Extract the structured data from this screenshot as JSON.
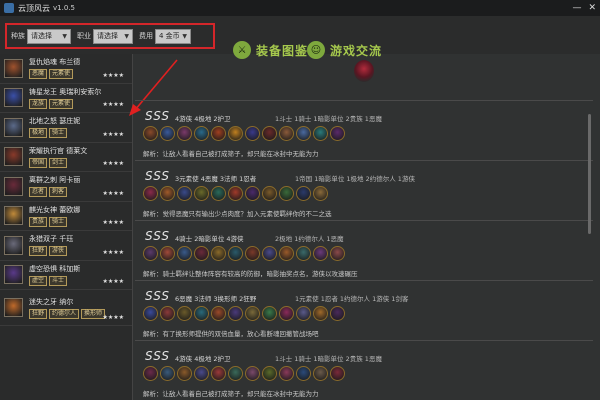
{
  "window": {
    "title": "云顶风云",
    "version": "v1.0.5",
    "buttons": [
      "—",
      "✕"
    ]
  },
  "filters": [
    {
      "label": "种族",
      "value": "请选择"
    },
    {
      "label": "职业",
      "value": "请选择"
    },
    {
      "label": "费用",
      "value": "4 金币"
    }
  ],
  "nav": [
    {
      "label": "装备图鉴",
      "icon": "sword-icon"
    },
    {
      "label": "游戏交流",
      "icon": "chat-icon"
    }
  ],
  "heroes": [
    {
      "name": "复仇焰魂 布兰德",
      "tags": [
        "恶魔",
        "元素使"
      ],
      "stars": "★★★★",
      "color": "#a0522d"
    },
    {
      "name": "铸星龙王 奥瑞利安索尔",
      "tags": [
        "龙族",
        "元素使"
      ],
      "stars": "★★★★",
      "color": "#3a4fa8"
    },
    {
      "name": "北地之怒 瑟庄妮",
      "tags": [
        "极地",
        "骑士"
      ],
      "stars": "★★★★",
      "color": "#5b6a8a"
    },
    {
      "name": "荣耀执行官 德莱文",
      "tags": [
        "帝国",
        "剑士"
      ],
      "stars": "★★★★",
      "color": "#8a3a2a"
    },
    {
      "name": "离群之刺 阿卡丽",
      "tags": [
        "忍者",
        "刺客"
      ],
      "stars": "★★★★",
      "color": "#6a2a3a"
    },
    {
      "name": "麒光女神 蕾欧娜",
      "tags": [
        "贵族",
        "骑士"
      ],
      "stars": "★★★★",
      "color": "#c08a3a"
    },
    {
      "name": "永猎双子 千珏",
      "tags": [
        "狂野",
        "游侠"
      ],
      "stars": "★★★★",
      "color": "#6a6a7a"
    },
    {
      "name": "虚空恐惧 科加斯",
      "tags": [
        "虚空",
        "斗士"
      ],
      "stars": "★★★★",
      "color": "#5a3a8a"
    },
    {
      "name": "迷失之牙 纳尔",
      "tags": [
        "狂野",
        "约德尔人",
        "换形师"
      ],
      "stars": "★★★★",
      "color": "#c06a2a"
    }
  ],
  "comps": [
    {
      "rank": "SSS",
      "synergy": "4游侠 4极地 2护卫",
      "extra": "1斗士 1骑士 1暗影单位 2贵族 1恶魔",
      "note": "解析：让敌人看着自己被打成筛子，却只能在冰封中无能为力",
      "icons": [
        "#8a4a2a",
        "#3a5a9a",
        "#7a3a6a",
        "#2a6a8a",
        "#a04020",
        "#c08020",
        "#3a3a8a",
        "#6a2a2a",
        "#8a5a3a",
        "#4a6aa0",
        "#2a7a7a",
        "#5a2a6a"
      ]
    },
    {
      "rank": "SSS",
      "synergy": "3元素使 4恶魔 3法师 1忍者",
      "extra": "1帝国 1暗影单位 1极地 2约德尔人 1游侠",
      "note": "解析：觉得恶魔只有输出少点肉度？加入元素使羁绊你的不二之选",
      "icons": [
        "#8a2a4a",
        "#a05a2a",
        "#3a4a8a",
        "#6a6a2a",
        "#2a6a5a",
        "#a03a2a",
        "#4a2a6a",
        "#7a5a2a",
        "#3a6a3a",
        "#2a3a6a",
        "#8a6a3a"
      ]
    },
    {
      "rank": "SSS",
      "synergy": "4骑士 2暗影单位 4游侠",
      "extra": "2极地 1约德尔人 1恶魔",
      "note": "解析：骑士羁绊让整体阵容有较高的防御，暗影抽奖点名，游侠以攻速碾压",
      "icons": [
        "#5a3a6a",
        "#a04a3a",
        "#3a5a8a",
        "#6a2a3a",
        "#8a6a2a",
        "#2a5a6a",
        "#7a3a2a",
        "#4a4a8a",
        "#9a5a2a",
        "#3a6a6a",
        "#6a3a7a",
        "#8a4a4a"
      ]
    },
    {
      "rank": "SSS",
      "synergy": "6恶魔 3法师 3换形师 2狂野",
      "extra": "1元素使 1忍者 1约德尔人 1游侠 1剑客",
      "note": "解析：有了换形师提供的双倍血量，放心看断魂回撤管战场吧",
      "icons": [
        "#3a4a9a",
        "#8a3a3a",
        "#6a5a2a",
        "#2a6a7a",
        "#9a4a2a",
        "#4a3a7a",
        "#7a6a3a",
        "#3a7a4a",
        "#8a2a5a",
        "#5a5a8a",
        "#a06a2a",
        "#4a2a5a"
      ]
    },
    {
      "rank": "SSS",
      "synergy": "4游侠 4极地 2护卫",
      "extra": "1斗士 1骑士 1暗影单位 2贵族 1恶魔",
      "note": "解析：让敌人看着自己被打成筛子，却只能在冰封中无能为力",
      "icons": [
        "#6a2a4a",
        "#3a5a7a",
        "#8a5a2a",
        "#4a4a8a",
        "#9a3a3a",
        "#3a6a5a",
        "#7a4a6a",
        "#5a6a2a",
        "#8a3a5a",
        "#2a4a7a",
        "#6a5a4a",
        "#7a2a3a"
      ]
    }
  ]
}
